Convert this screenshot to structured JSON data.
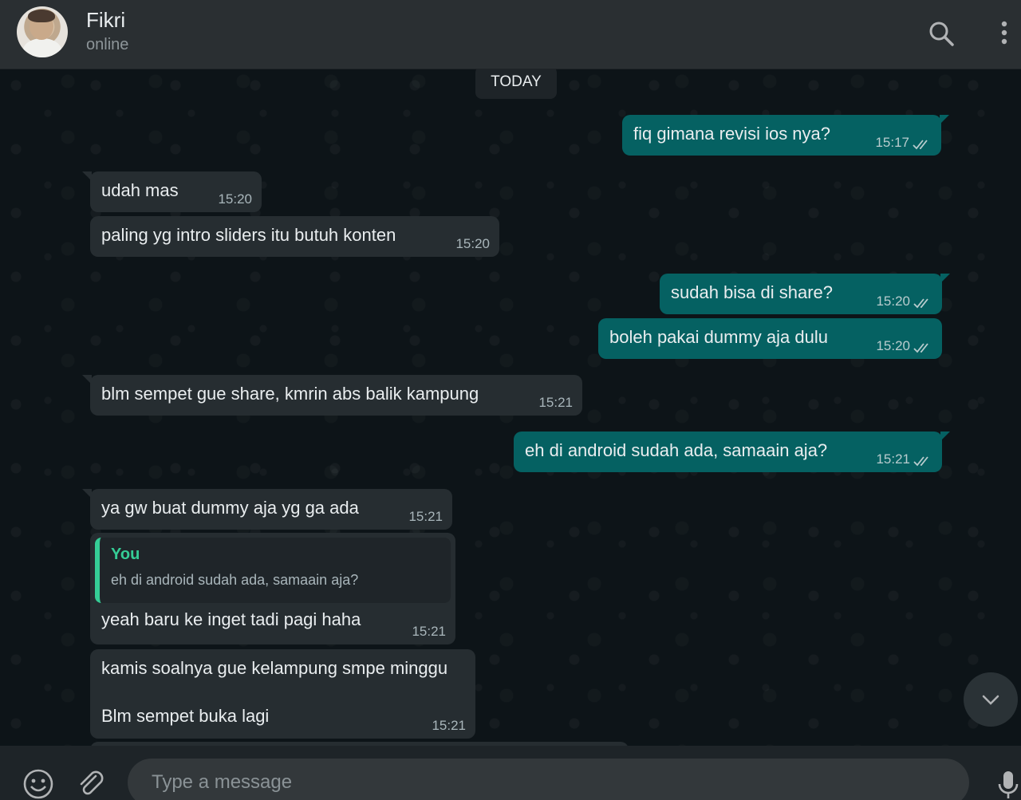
{
  "header": {
    "contact_name": "Fikri",
    "status": "online",
    "icons": [
      "search-icon",
      "menu-icon"
    ]
  },
  "chat": {
    "date_label": "TODAY",
    "messages": [
      {
        "dir": "out",
        "text": "fiq gimana revisi ios nya?",
        "time": "15:17"
      },
      {
        "dir": "in",
        "text": "udah mas",
        "time": "15:20"
      },
      {
        "dir": "in",
        "text": "paling yg intro sliders itu butuh konten",
        "time": "15:20"
      },
      {
        "dir": "out",
        "text": "sudah bisa di share?",
        "time": "15:20"
      },
      {
        "dir": "out",
        "text": "boleh pakai dummy aja dulu",
        "time": "15:20"
      },
      {
        "dir": "in",
        "text": "blm sempet gue share, kmrin abs balik kampung",
        "time": "15:21"
      },
      {
        "dir": "out",
        "text": "eh di android sudah ada, samaain aja?",
        "time": "15:21"
      },
      {
        "dir": "in",
        "text": "ya gw buat dummy aja yg ga ada",
        "time": "15:21"
      },
      {
        "dir": "in",
        "quote_name": "You",
        "quote_text": "eh di android sudah ada, samaain aja?",
        "text": "yeah baru ke inget tadi pagi haha",
        "time": "15:21"
      },
      {
        "dir": "in",
        "text_line1": "kamis soalnya gue kelampung smpe minggu",
        "text_line2": "Blm sempet buka lagi",
        "time": "15:21"
      }
    ]
  },
  "footer": {
    "placeholder": "Type a message",
    "icons": [
      "emoji-icon",
      "attach-icon",
      "mic-icon"
    ]
  },
  "colors": {
    "header_bg": "#2a2f32",
    "incoming_bubble": "#262d31",
    "outgoing_bubble": "#056162",
    "quote_accent": "#35cd96"
  }
}
